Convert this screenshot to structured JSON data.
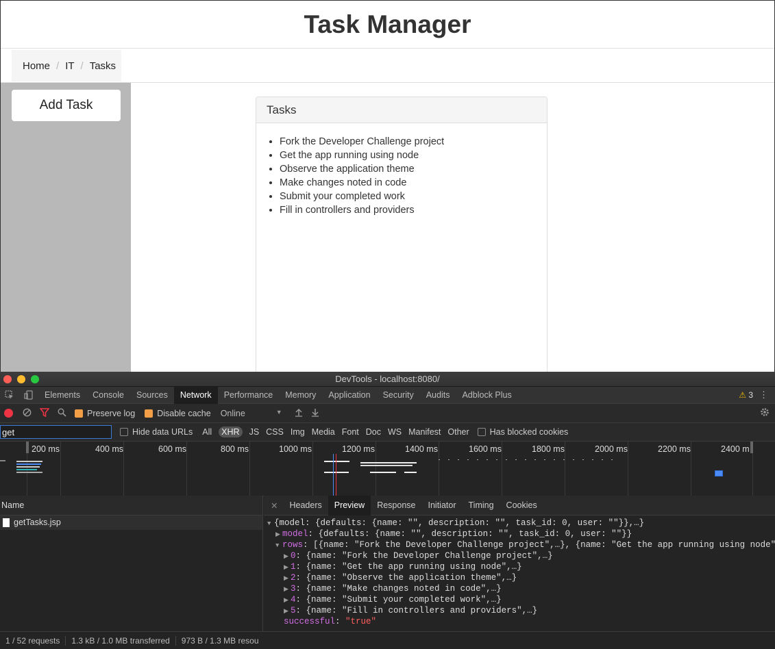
{
  "app": {
    "title": "Task Manager",
    "breadcrumb": [
      "Home",
      "IT",
      "Tasks"
    ],
    "add_task_label": "Add Task",
    "panel_title": "Tasks",
    "tasks": [
      "Fork the Developer Challenge project",
      "Get the app running using node",
      "Observe the application theme",
      "Make changes noted in code",
      "Submit your completed work",
      "Fill in controllers and providers"
    ]
  },
  "devtools": {
    "window_title": "DevTools - localhost:8080/",
    "tabs": [
      "Elements",
      "Console",
      "Sources",
      "Network",
      "Performance",
      "Memory",
      "Application",
      "Security",
      "Audits",
      "Adblock Plus"
    ],
    "active_tab": "Network",
    "warning_count": "3",
    "toolbar": {
      "preserve_log": "Preserve log",
      "disable_cache": "Disable cache",
      "throttle": "Online"
    },
    "filter": {
      "value": "get",
      "hide_data_urls": "Hide data URLs",
      "types": [
        "All",
        "XHR",
        "JS",
        "CSS",
        "Img",
        "Media",
        "Font",
        "Doc",
        "WS",
        "Manifest",
        "Other"
      ],
      "active_type": "XHR",
      "blocked_cookies": "Has blocked cookies"
    },
    "timeline_ticks": [
      "200 ms",
      "400 ms",
      "600 ms",
      "800 ms",
      "1000 ms",
      "1200 ms",
      "1400 ms",
      "1600 ms",
      "1800 ms",
      "2000 ms",
      "2200 ms",
      "2400 m"
    ],
    "name_header": "Name",
    "requests": [
      "getTasks.jsp"
    ],
    "detail_tabs": [
      "Headers",
      "Preview",
      "Response",
      "Initiator",
      "Timing",
      "Cookies"
    ],
    "active_detail_tab": "Preview",
    "preview": {
      "root": "{model: {defaults: {name: \"\", description: \"\", task_id: 0, user: \"\"}},…}",
      "model_key": "model",
      "model_val": "{defaults: {name: \"\", description: \"\", task_id: 0, user: \"\"}}",
      "rows_key": "rows",
      "rows_val": "[{name: \"Fork the Developer Challenge project\",…}, {name: \"Get the app running using node\",…}",
      "rows": [
        {
          "idx": "0",
          "val": "{name: \"Fork the Developer Challenge project\",…}"
        },
        {
          "idx": "1",
          "val": "{name: \"Get the app running using node\",…}"
        },
        {
          "idx": "2",
          "val": "{name: \"Observe the application theme\",…}"
        },
        {
          "idx": "3",
          "val": "{name: \"Make changes noted in code\",…}"
        },
        {
          "idx": "4",
          "val": "{name: \"Submit your completed work\",…}"
        },
        {
          "idx": "5",
          "val": "{name: \"Fill in controllers and providers\",…}"
        }
      ],
      "successful_key": "successful",
      "successful_val": "\"true\""
    },
    "status": [
      "1 / 52 requests",
      "1.3 kB / 1.0 MB transferred",
      "973 B / 1.3 MB resou"
    ]
  }
}
